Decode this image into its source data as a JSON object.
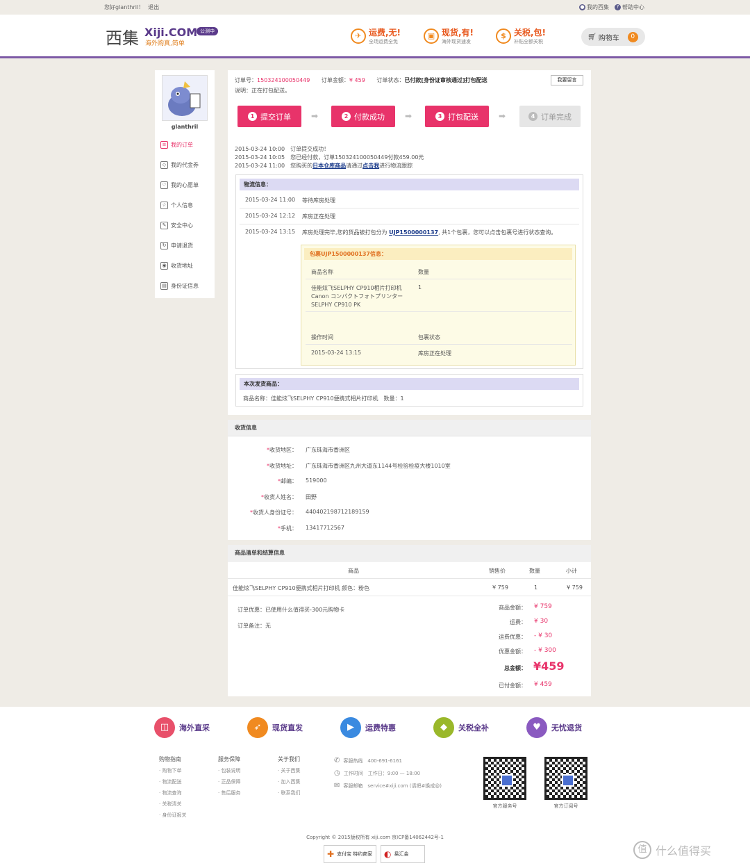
{
  "topbar": {
    "greeting": "您好glanthril！",
    "logout": "退出",
    "my_xiji": "我的西集",
    "help": "帮助中心"
  },
  "header": {
    "logo_cn": "西集",
    "logo_en": "Xiji.COM",
    "slogan": "海外购真,简单",
    "beta": "公测中",
    "promos": [
      {
        "icon": "plane-icon",
        "glyph": "✈",
        "title": "运费,无!",
        "sub": "全场运费全免"
      },
      {
        "icon": "box-icon",
        "glyph": "▣",
        "title": "现货,有!",
        "sub": "海外现货速发"
      },
      {
        "icon": "money-icon",
        "glyph": "$",
        "title": "关税,包!",
        "sub": "补贴全额关税"
      }
    ],
    "cart_label": "购物车",
    "cart_count": "0"
  },
  "sidebar": {
    "username": "glanthril",
    "items": [
      {
        "label": "我的订单",
        "icon": "order-icon",
        "glyph": "≡"
      },
      {
        "label": "我的代金券",
        "icon": "coupon-icon",
        "glyph": "◇"
      },
      {
        "label": "我的心愿单",
        "icon": "heart-icon",
        "glyph": "♡"
      },
      {
        "label": "个人信息",
        "icon": "star-icon",
        "glyph": "☆"
      },
      {
        "label": "安全中心",
        "icon": "edit-icon",
        "glyph": "✎"
      },
      {
        "label": "申请退货",
        "icon": "return-icon",
        "glyph": "↻"
      },
      {
        "label": "收货地址",
        "icon": "location-icon",
        "glyph": "◉"
      },
      {
        "label": "身份证信息",
        "icon": "id-icon",
        "glyph": "▤"
      }
    ]
  },
  "order": {
    "no_label": "订单号：",
    "no": "150324100050449",
    "amount_label": "订单金额：",
    "amount": "¥ 459",
    "status_label": "订单状态：",
    "status": "已付款[身份证审核通过]打包配送",
    "note_label": "说明：",
    "note": "正在打包配送。",
    "msg_button": "我要留言",
    "steps": [
      {
        "num": "1",
        "label": "提交订单"
      },
      {
        "num": "2",
        "label": "付款成功"
      },
      {
        "num": "3",
        "label": "打包配送"
      },
      {
        "num": "4",
        "label": "订单完成"
      }
    ],
    "logs": [
      {
        "time": "2015-03-24 10:00",
        "text": "订单提交成功！"
      },
      {
        "time": "2015-03-24 10:05",
        "text": "您已经付款，订单150324100050449付款459.00元"
      },
      {
        "time": "2015-03-24 11:00",
        "pre": "您购买的",
        "link1": "日本仓库商品",
        "mid": "请通过",
        "link2": "点击我",
        "post": "进行物流跟踪"
      }
    ]
  },
  "logistics": {
    "title": "物流信息：",
    "rows": [
      {
        "time": "2015-03-24 11:00",
        "text": "等待库房处理"
      },
      {
        "time": "2015-03-24 12:12",
        "text": "库房正在处理"
      },
      {
        "time": "2015-03-24 13:15",
        "pre": "库房处理完毕,您的货品被打包分为",
        "pkg": "UJP1500000137",
        "post": "共1个包裹，您可以点击包裹号进行状态查询。"
      }
    ],
    "package": {
      "title": "包裹UJP1500000137信息：",
      "col_name": "商品名称",
      "col_qty": "数量",
      "item_line1": "佳能炫飞SELPHY CP910相片打印机",
      "item_line2": "Canon コンパクトフォトプリンター",
      "item_line3": "SELPHY CP910 PK",
      "item_qty": "1",
      "col_time": "操作时间",
      "col_status": "包裹状态",
      "op_time": "2015-03-24 13:15",
      "op_status": "库房正在处理"
    }
  },
  "shipment": {
    "title": "本次发货商品：",
    "text": "商品名称：佳能炫飞SELPHY CP910便携式相片打印机　数量：1"
  },
  "receiver": {
    "title": "收货信息",
    "fields": [
      {
        "label": "收货地区：",
        "value": "广东珠海市香洲区"
      },
      {
        "label": "收货地址：",
        "value": "广东珠海市香洲区九州大道东1144号检验检疫大楼1010室"
      },
      {
        "label": "邮编：",
        "value": "519000"
      },
      {
        "label": "收货人姓名：",
        "value": "田野"
      },
      {
        "label": "收货人身份证号：",
        "value": "440402198712189159"
      },
      {
        "label": "手机：",
        "value": "13417712567"
      }
    ]
  },
  "goods": {
    "title": "商品清单和结算信息",
    "col_item": "商品",
    "col_price": "销售价",
    "col_qty": "数量",
    "col_sub": "小计",
    "item": "佳能炫飞SELPHY CP910便携式相片打印机  颜色：粉色",
    "price": "¥ 759",
    "qty": "1",
    "subtotal": "¥ 759",
    "discount_label": "订单优惠：",
    "discount": "已使用什么值得买-300元购物卡",
    "remark_label": "订单备注：",
    "remark": "无",
    "totals": [
      {
        "label": "商品金额：",
        "value": "¥ 759"
      },
      {
        "label": "运费：",
        "value": "¥ 30"
      },
      {
        "label": "运费优惠：",
        "value": "- ¥ 30"
      },
      {
        "label": "优惠金额：",
        "value": "- ¥ 300"
      }
    ],
    "grand_label": "总金额：",
    "grand": "¥459",
    "paid_label": "已付金额：",
    "paid": "¥ 459"
  },
  "footer": {
    "features": [
      {
        "label": "海外直采",
        "icon": "bag-icon",
        "glyph": "◫",
        "color": "#e8506a"
      },
      {
        "label": "现货直发",
        "icon": "rocket-icon",
        "glyph": "➶",
        "color": "#f08a20"
      },
      {
        "label": "运费特惠",
        "icon": "truck-icon",
        "glyph": "▶",
        "color": "#3a8ae0"
      },
      {
        "label": "关税全补",
        "icon": "shield-icon",
        "glyph": "◆",
        "color": "#9ab82a"
      },
      {
        "label": "无忧退货",
        "icon": "heart-icon",
        "glyph": "♥",
        "color": "#8a5ac0"
      }
    ],
    "cols": [
      {
        "head": "购物指南",
        "items": [
          "购物下单",
          "物流配送",
          "物流查询",
          "关税清关",
          "身份证报关"
        ]
      },
      {
        "head": "服务保障",
        "items": [
          "包装说明",
          "正品保障",
          "售后服务"
        ]
      },
      {
        "head": "关于我们",
        "items": [
          "关于西集",
          "加入西集",
          "联系我们"
        ]
      }
    ],
    "contact": [
      {
        "icon": "phone-icon",
        "glyph": "✆",
        "label": "客服热线",
        "value": "400-691-6161"
      },
      {
        "icon": "clock-icon",
        "glyph": "◷",
        "label": "工作时间",
        "value": "工作日：9:00 — 18:00"
      },
      {
        "icon": "mail-icon",
        "glyph": "✉",
        "label": "客服邮箱",
        "value": "service#xiji.com (请把#换成@)"
      }
    ],
    "qr1": "官方服务号",
    "qr2": "官方订阅号",
    "copyright": "Copyright © 2015版权所有 xiji.com 京ICP备14062442号-1",
    "cert1": "支付宝 特约商家",
    "cert2": "易汇金"
  },
  "watermark": "什么值得买"
}
